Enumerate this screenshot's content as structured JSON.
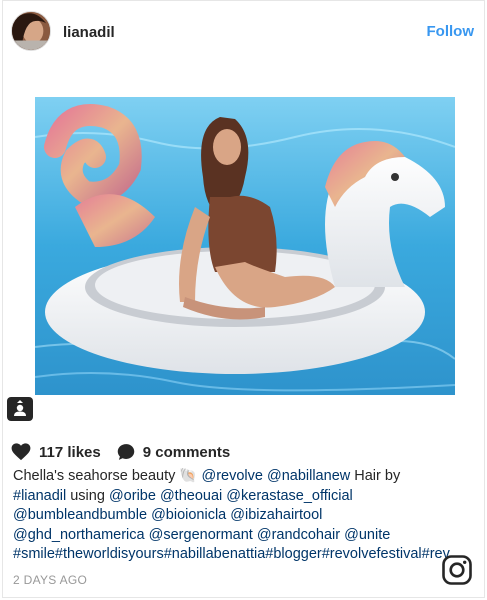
{
  "post": {
    "username": "lianadil",
    "follow_label": "Follow",
    "likes": "117 likes",
    "comments": "9 comments",
    "caption_lines": [
      [
        {
          "t": "text",
          "v": "Chella's seahorse beauty 🐚 "
        },
        {
          "t": "handle",
          "v": "@revolve"
        },
        {
          "t": "text",
          "v": " "
        },
        {
          "t": "handle",
          "v": "@nabillanew"
        },
        {
          "t": "text",
          "v": " Hair by"
        }
      ],
      [
        {
          "t": "handle",
          "v": "#lianadil"
        },
        {
          "t": "text",
          "v": " using "
        },
        {
          "t": "handle",
          "v": "@oribe"
        },
        {
          "t": "text",
          "v": " "
        },
        {
          "t": "handle",
          "v": "@theouai"
        },
        {
          "t": "text",
          "v": " "
        },
        {
          "t": "handle",
          "v": "@kerastase_official"
        }
      ],
      [
        {
          "t": "handle",
          "v": "@bumbleandbumble"
        },
        {
          "t": "text",
          "v": " "
        },
        {
          "t": "handle",
          "v": "@bioionicla"
        },
        {
          "t": "text",
          "v": " "
        },
        {
          "t": "handle",
          "v": "@ibizahairtool"
        }
      ],
      [
        {
          "t": "handle",
          "v": "@ghd_northamerica"
        },
        {
          "t": "text",
          "v": " "
        },
        {
          "t": "handle",
          "v": "@sergenormant"
        },
        {
          "t": "text",
          "v": " "
        },
        {
          "t": "handle",
          "v": "@randcohair"
        },
        {
          "t": "text",
          "v": " "
        },
        {
          "t": "handle",
          "v": "@unite"
        }
      ],
      [
        {
          "t": "handle",
          "v": "#smile#theworldisyours#nabillabenattia#blogger#revolvefestival#rev"
        }
      ]
    ],
    "timestamp": "2 DAYS AGO"
  },
  "icons": {
    "like": "heart-icon",
    "comment": "comment-bubble-icon",
    "tag": "tagged-user-icon",
    "brand": "instagram-logo-icon"
  },
  "colors": {
    "link": "#3897f0",
    "handle": "#003569",
    "text": "#262626",
    "muted": "#999999"
  }
}
